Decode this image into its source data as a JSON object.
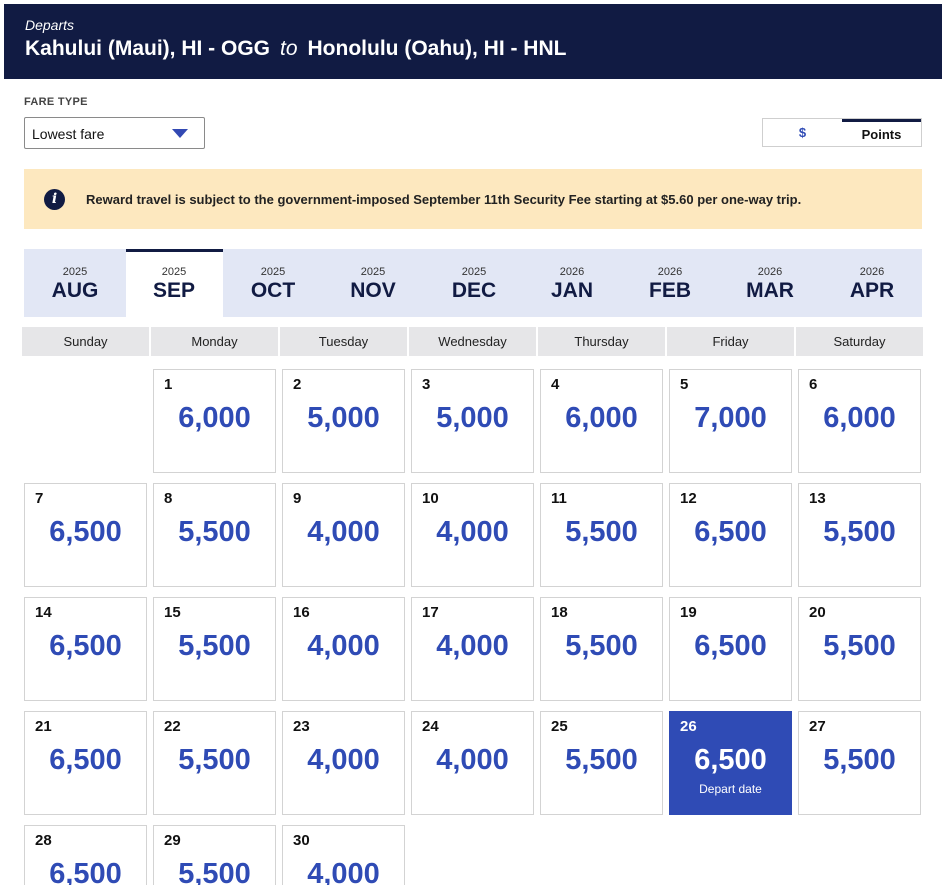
{
  "header": {
    "departs_label": "Departs",
    "origin": "Kahului (Maui), HI - OGG",
    "to_word": "to",
    "destination": "Honolulu (Oahu), HI - HNL"
  },
  "fare_type": {
    "label": "FARE TYPE",
    "selected": "Lowest fare"
  },
  "currency_toggle": {
    "dollar_label": "$",
    "points_label": "Points",
    "active": "points"
  },
  "notice": {
    "icon": "info-icon",
    "text": "Reward travel is subject to the government-imposed September 11th Security Fee starting at $5.60 per one-way trip."
  },
  "months": [
    {
      "year": "2025",
      "month": "AUG"
    },
    {
      "year": "2025",
      "month": "SEP"
    },
    {
      "year": "2025",
      "month": "OCT"
    },
    {
      "year": "2025",
      "month": "NOV"
    },
    {
      "year": "2025",
      "month": "DEC"
    },
    {
      "year": "2026",
      "month": "JAN"
    },
    {
      "year": "2026",
      "month": "FEB"
    },
    {
      "year": "2026",
      "month": "MAR"
    },
    {
      "year": "2026",
      "month": "APR"
    }
  ],
  "active_month_index": 1,
  "weekdays": [
    "Sunday",
    "Monday",
    "Tuesday",
    "Wednesday",
    "Thursday",
    "Friday",
    "Saturday"
  ],
  "days": [
    {
      "day": "1",
      "points": "6,000"
    },
    {
      "day": "2",
      "points": "5,000"
    },
    {
      "day": "3",
      "points": "5,000"
    },
    {
      "day": "4",
      "points": "6,000"
    },
    {
      "day": "5",
      "points": "7,000"
    },
    {
      "day": "6",
      "points": "6,000"
    },
    {
      "day": "7",
      "points": "6,500"
    },
    {
      "day": "8",
      "points": "5,500"
    },
    {
      "day": "9",
      "points": "4,000"
    },
    {
      "day": "10",
      "points": "4,000"
    },
    {
      "day": "11",
      "points": "5,500"
    },
    {
      "day": "12",
      "points": "6,500"
    },
    {
      "day": "13",
      "points": "5,500"
    },
    {
      "day": "14",
      "points": "6,500"
    },
    {
      "day": "15",
      "points": "5,500"
    },
    {
      "day": "16",
      "points": "4,000"
    },
    {
      "day": "17",
      "points": "4,000"
    },
    {
      "day": "18",
      "points": "5,500"
    },
    {
      "day": "19",
      "points": "6,500"
    },
    {
      "day": "20",
      "points": "5,500"
    },
    {
      "day": "21",
      "points": "6,500"
    },
    {
      "day": "22",
      "points": "5,500"
    },
    {
      "day": "23",
      "points": "4,000"
    },
    {
      "day": "24",
      "points": "4,000"
    },
    {
      "day": "25",
      "points": "5,500"
    },
    {
      "day": "26",
      "points": "6,500",
      "selected": true,
      "sublabel": "Depart date"
    },
    {
      "day": "27",
      "points": "5,500"
    },
    {
      "day": "28",
      "points": "6,500"
    },
    {
      "day": "29",
      "points": "5,500"
    },
    {
      "day": "30",
      "points": "4,000"
    }
  ],
  "first_weekday_offset": 1,
  "colors": {
    "header_bg": "#111b43",
    "accent_blue": "#2f4bb5",
    "notice_bg": "#fde8bf",
    "month_bar_bg": "#e2e7f5"
  }
}
